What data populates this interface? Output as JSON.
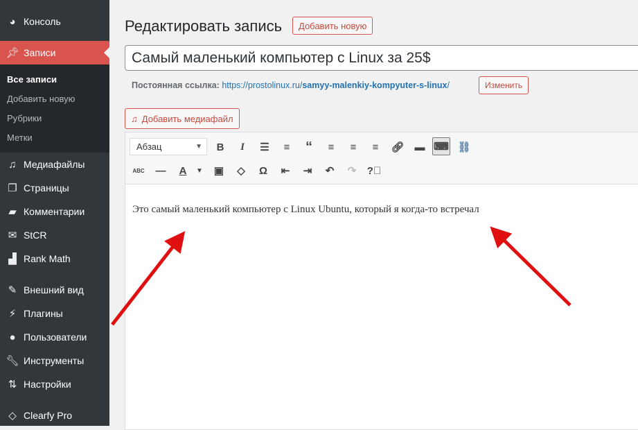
{
  "sidebar": {
    "items": [
      {
        "label": "Консоль",
        "icon": "dashboard-icon"
      },
      {
        "label": "Записи",
        "icon": "pin-icon",
        "active": true
      },
      {
        "label": "Медиафайлы",
        "icon": "media-icon"
      },
      {
        "label": "Страницы",
        "icon": "pages-icon"
      },
      {
        "label": "Комментарии",
        "icon": "comment-icon"
      },
      {
        "label": "StCR",
        "icon": "mail-icon"
      },
      {
        "label": "Rank Math",
        "icon": "chart-icon"
      },
      {
        "label": "Внешний вид",
        "icon": "brush-icon"
      },
      {
        "label": "Плагины",
        "icon": "plugin-icon"
      },
      {
        "label": "Пользователи",
        "icon": "user-icon"
      },
      {
        "label": "Инструменты",
        "icon": "wrench-icon"
      },
      {
        "label": "Настройки",
        "icon": "settings-icon"
      },
      {
        "label": "Clearfy Pro",
        "icon": "diamond-icon"
      }
    ],
    "submenu": [
      "Все записи",
      "Добавить новую",
      "Рубрики",
      "Метки"
    ]
  },
  "header": {
    "title": "Редактировать запись",
    "add_new": "Добавить новую"
  },
  "post": {
    "title": "Самый маленький компьютер с Linux за 25$",
    "permalink_label": "Постоянная ссылка:",
    "permalink_base": "https://prostolinux.ru/",
    "permalink_slug": "samyy-malenkiy-kompyuter-s-linux",
    "permalink_end": "/",
    "change": "Изменить",
    "add_media": "Добавить медиафайл",
    "format": "Абзац",
    "content": "Это самый маленький компьютер с Linux Ubuntu, который я когда-то встречал"
  },
  "colors": {
    "accent": "#d9534f",
    "sidebar": "#32373c",
    "link": "#2271b1",
    "arrow": "#e01010"
  }
}
